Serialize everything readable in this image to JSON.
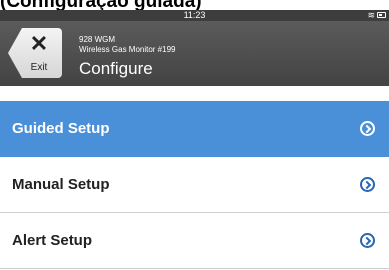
{
  "caption": "(Configuração guiada)",
  "status_bar": {
    "time": "11:23",
    "wifi_icon": "wifi-icon",
    "battery_icon": "battery-icon"
  },
  "header": {
    "exit_label": "Exit",
    "exit_icon": "close-icon",
    "device_model": "928 WGM",
    "device_name": "Wireless Gas Monitor #199",
    "page_title": "Configure"
  },
  "menu": {
    "items": [
      {
        "label": "Guided Setup",
        "selected": true
      },
      {
        "label": "Manual Setup",
        "selected": false
      },
      {
        "label": "Alert Setup",
        "selected": false
      }
    ]
  },
  "colors": {
    "selected_bg": "#4a90d9",
    "chevron": "#2566b8",
    "header_bg": "#4d4d4d"
  }
}
